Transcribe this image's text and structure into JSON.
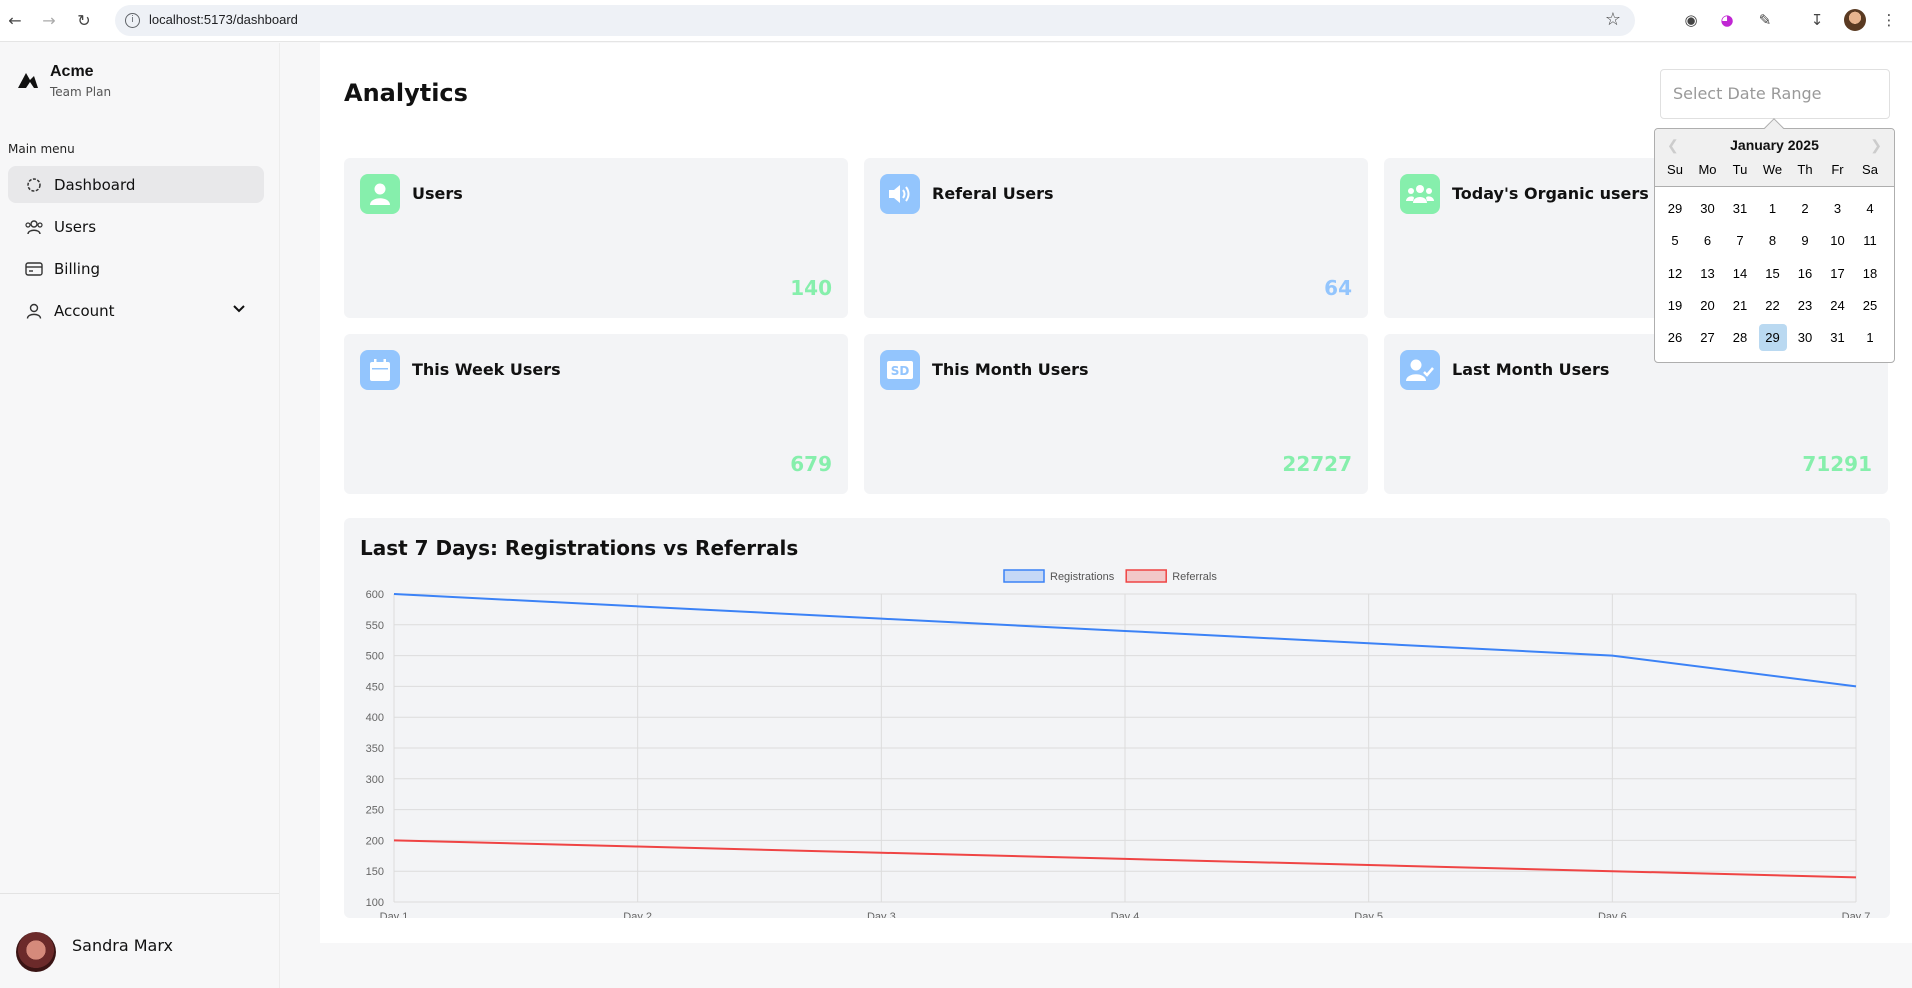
{
  "browser": {
    "url": "localhost:5173/dashboard"
  },
  "sidebar": {
    "brand_name": "Acme",
    "brand_plan": "Team Plan",
    "menu_label": "Main menu",
    "items": [
      {
        "label": "Dashboard",
        "icon": "dashboard-icon",
        "active": true
      },
      {
        "label": "Users",
        "icon": "users-icon"
      },
      {
        "label": "Billing",
        "icon": "billing-icon"
      },
      {
        "label": "Account",
        "icon": "account-icon"
      }
    ],
    "user_name": "Sandra Marx"
  },
  "main": {
    "title": "Analytics",
    "date_placeholder": "Select Date Range",
    "cards": [
      {
        "title": "Users",
        "value": "140",
        "icon": "user-icon",
        "color": "#86efac"
      },
      {
        "title": "Referal Users",
        "value": "64",
        "icon": "speaker-icon",
        "color": "#93c5fd"
      },
      {
        "title": "Today's Organic users",
        "value": "",
        "icon": "group-icon",
        "color": "#86efac"
      },
      {
        "title": "This Week Users",
        "value": "679",
        "icon": "calendar-icon",
        "color": "#93c5fd"
      },
      {
        "title": "This Month Users",
        "value": "22727",
        "icon": "sd-icon",
        "color": "#93c5fd"
      },
      {
        "title": "Last Month Users",
        "value": "71291",
        "icon": "user-check-icon",
        "color": "#93c5fd"
      }
    ],
    "value_color": "#86efac"
  },
  "calendar": {
    "month": "January 2025",
    "dow": [
      "Su",
      "Mo",
      "Tu",
      "We",
      "Th",
      "Fr",
      "Sa"
    ],
    "weeks": [
      [
        "29",
        "30",
        "31",
        "1",
        "2",
        "3",
        "4"
      ],
      [
        "5",
        "6",
        "7",
        "8",
        "9",
        "10",
        "11"
      ],
      [
        "12",
        "13",
        "14",
        "15",
        "16",
        "17",
        "18"
      ],
      [
        "19",
        "20",
        "21",
        "22",
        "23",
        "24",
        "25"
      ],
      [
        "26",
        "27",
        "28",
        "29",
        "30",
        "31",
        "1"
      ]
    ],
    "selected": "29"
  },
  "chart_data": {
    "type": "line",
    "title": "Last 7 Days: Registrations vs Referrals",
    "categories": [
      "Day 1",
      "Day 2",
      "Day 3",
      "Day 4",
      "Day 5",
      "Day 6",
      "Day 7"
    ],
    "series": [
      {
        "name": "Registrations",
        "values": [
          600,
          580,
          560,
          540,
          520,
          500,
          450
        ],
        "color": "#3b82f6"
      },
      {
        "name": "Referrals",
        "values": [
          200,
          190,
          180,
          170,
          160,
          150,
          140
        ],
        "color": "#ef4444"
      }
    ],
    "ylim": [
      100,
      600
    ],
    "yticks": [
      "600",
      "550",
      "500",
      "450",
      "400",
      "350",
      "300",
      "250",
      "200",
      "150",
      "100"
    ],
    "legend": "top-center",
    "grid": true
  }
}
